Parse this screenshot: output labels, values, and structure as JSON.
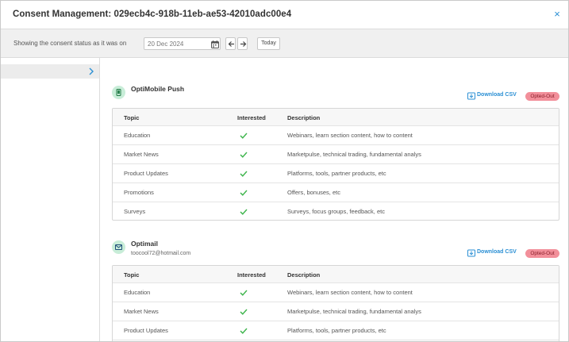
{
  "header": {
    "title": "Consent Management: 029ecb4c-918b-11eb-ae53-42010adc00e4",
    "close_label": "×"
  },
  "statusbar": {
    "label": "Showing the consent status as it was on",
    "date_value": "20 Dec 2024",
    "today_label": "Today"
  },
  "icons": {
    "calendar": "calendar-icon",
    "prev": "arrow-left-icon",
    "next": "arrow-right-icon",
    "chevron": "chevron-right-icon",
    "push": "mobile-icon",
    "mail": "envelope-icon",
    "download": "download-icon",
    "check": "check-icon"
  },
  "colors": {
    "accent": "#2a8fd4",
    "check": "#3cb44b",
    "badge_bg": "#f28f9a",
    "icon_bg": "#c8edd8"
  },
  "table_headers": {
    "topic": "Topic",
    "interested": "Interested",
    "description": "Description"
  },
  "channels": [
    {
      "name": "OptiMobile Push",
      "subtitle": "",
      "download_label": "Download CSV",
      "status_badge": "Opted-Out",
      "rows": [
        {
          "topic": "Education",
          "interested": true,
          "description": "Webinars, learn section content, how to content"
        },
        {
          "topic": "Market News",
          "interested": true,
          "description": "Marketpulse, technical trading, fundamental analys"
        },
        {
          "topic": "Product Updates",
          "interested": true,
          "description": "Platforms, tools, partner products, etc"
        },
        {
          "topic": "Promotions",
          "interested": true,
          "description": "Offers, bonuses, etc"
        },
        {
          "topic": "Surveys",
          "interested": true,
          "description": "Surveys, focus groups, feedback, etc"
        }
      ]
    },
    {
      "name": "Optimail",
      "subtitle": "toocool72@hotmail.com",
      "download_label": "Download CSV",
      "status_badge": "Opted-Out",
      "rows": [
        {
          "topic": "Education",
          "interested": true,
          "description": "Webinars, learn section content, how to content"
        },
        {
          "topic": "Market News",
          "interested": true,
          "description": "Marketpulse, technical trading, fundamental analys"
        },
        {
          "topic": "Product Updates",
          "interested": true,
          "description": "Platforms, tools, partner products, etc"
        }
      ]
    }
  ]
}
